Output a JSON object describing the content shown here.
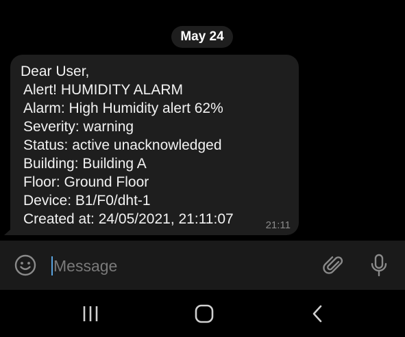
{
  "chat": {
    "date_chip": "May 24",
    "message": {
      "lines": [
        "Dear User,",
        "Alert! HUMIDITY ALARM",
        "Alarm: High Humidity alert 62%",
        "Severity: warning",
        "Status: active unacknowledged",
        "Building: Building A",
        "Floor: Ground Floor",
        "Device: B1/F0/dht-1",
        "Created at: 24/05/2021, 21:11:07"
      ],
      "time": "21:11"
    }
  },
  "input_bar": {
    "placeholder": "Message",
    "value": "",
    "icons": {
      "emoji": "smiley-icon",
      "attach": "paperclip-icon",
      "mic": "microphone-icon"
    },
    "accent_color": "#5aa4e0"
  },
  "nav": {
    "icons": [
      "recents-icon",
      "home-icon",
      "back-icon"
    ]
  },
  "colors": {
    "background": "#000000",
    "bubble": "#1e1e1e",
    "input_bar": "#1a1a1a",
    "text": "#f2f2f2",
    "muted": "#8a8a8a"
  }
}
